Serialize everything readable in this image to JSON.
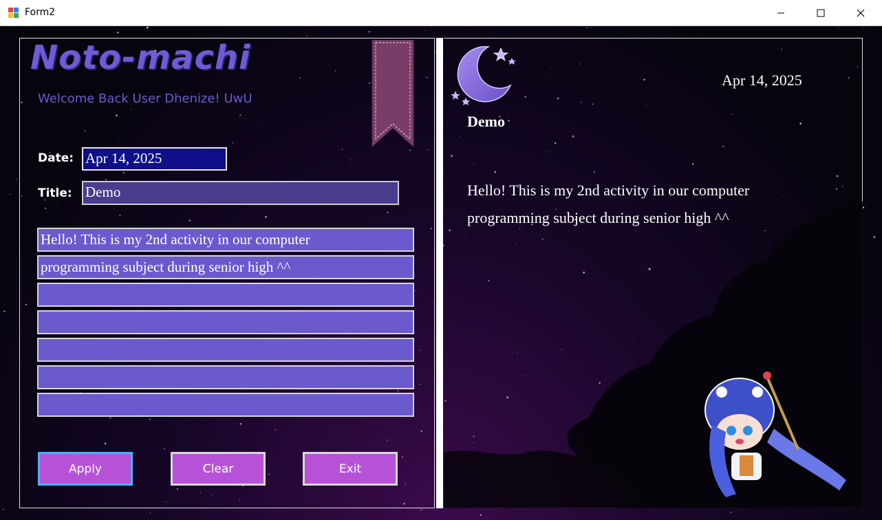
{
  "window": {
    "title": "Form2"
  },
  "left": {
    "logo": "Noto-machi",
    "welcome": "Welcome Back User Dhenize! UwU",
    "date_label": "Date:",
    "date_value": "Apr 14, 2025",
    "title_label": "Title:",
    "title_value": "Demo",
    "lines": [
      "Hello! This is my 2nd activity in our computer",
      "programming subject during senior high ^^",
      "",
      "",
      "",
      "",
      ""
    ],
    "buttons": {
      "apply": "Apply",
      "clear": "Clear",
      "exit": "Exit"
    }
  },
  "right": {
    "date": "Apr 14, 2025",
    "title": "Demo",
    "body_lines": [
      "Hello! This is my 2nd activity in our computer",
      "programming subject during senior high ^^"
    ]
  },
  "colors": {
    "accent_purple": "#6a5acd",
    "button": "#b752d8",
    "date_field": "#0f0f8a",
    "title_field": "#4a3b8c"
  },
  "icons": [
    "app-icon",
    "minimize-icon",
    "maximize-icon",
    "close-icon",
    "bookmark-ribbon-icon",
    "moon-stars-icon"
  ]
}
